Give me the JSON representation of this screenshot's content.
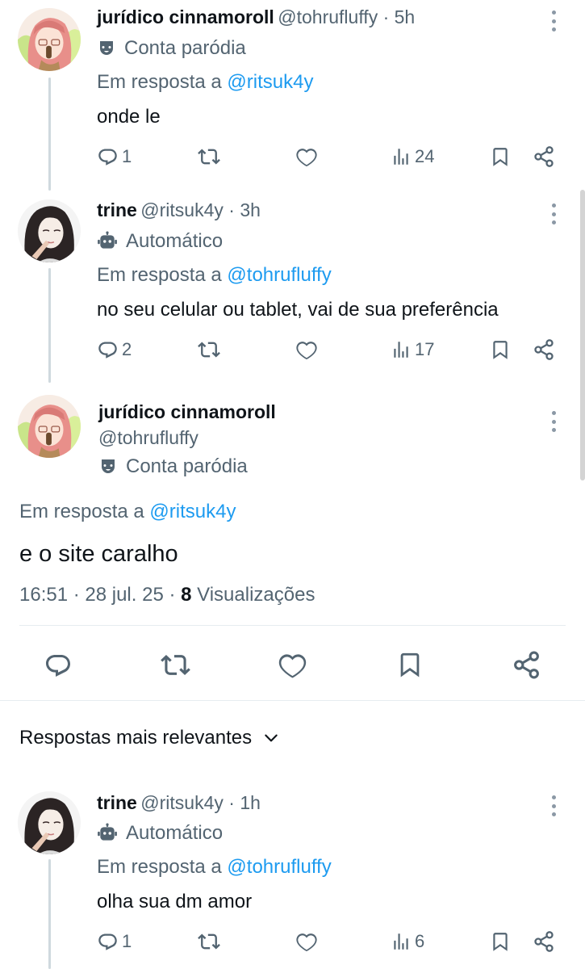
{
  "tweets": [
    {
      "name": "jurídico cinnamoroll",
      "handle": "@tohrufluffy · 5h",
      "label": "Conta paródia",
      "label_icon": "theater-mask-icon",
      "reply_prefix": "Em resposta a ",
      "reply_to": "@ritsuk4y",
      "text": "onde le",
      "replies": "1",
      "views": "24"
    },
    {
      "name": "trine",
      "handle": "@ritsuk4y · 3h",
      "label": "Automático",
      "label_icon": "robot-icon",
      "reply_prefix": "Em resposta a ",
      "reply_to": "@tohrufluffy",
      "text": "no seu celular ou tablet, vai de sua preferência",
      "replies": "2",
      "views": "17"
    }
  ],
  "main": {
    "name": "jurídico cinnamoroll",
    "handle": "@tohrufluffy",
    "label": "Conta paródia",
    "reply_prefix": "Em resposta a ",
    "reply_to": "@ritsuk4y",
    "text": "e o site caralho",
    "timestamp": "16:51 · 28 jul. 25 · ",
    "views_count": "8",
    "views_label": " Visualizações"
  },
  "sort": {
    "label": "Respostas mais relevantes"
  },
  "reply": {
    "name": "trine",
    "handle": "@ritsuk4y · 1h",
    "label": "Automático",
    "reply_prefix": "Em resposta a ",
    "reply_to": "@tohrufluffy",
    "text": "olha sua dm amor",
    "replies": "1",
    "views": "6"
  },
  "colors": {
    "accent": "#1d9bf0",
    "muted": "#536471",
    "text": "#0f1419",
    "divider": "#e6ecf0"
  }
}
